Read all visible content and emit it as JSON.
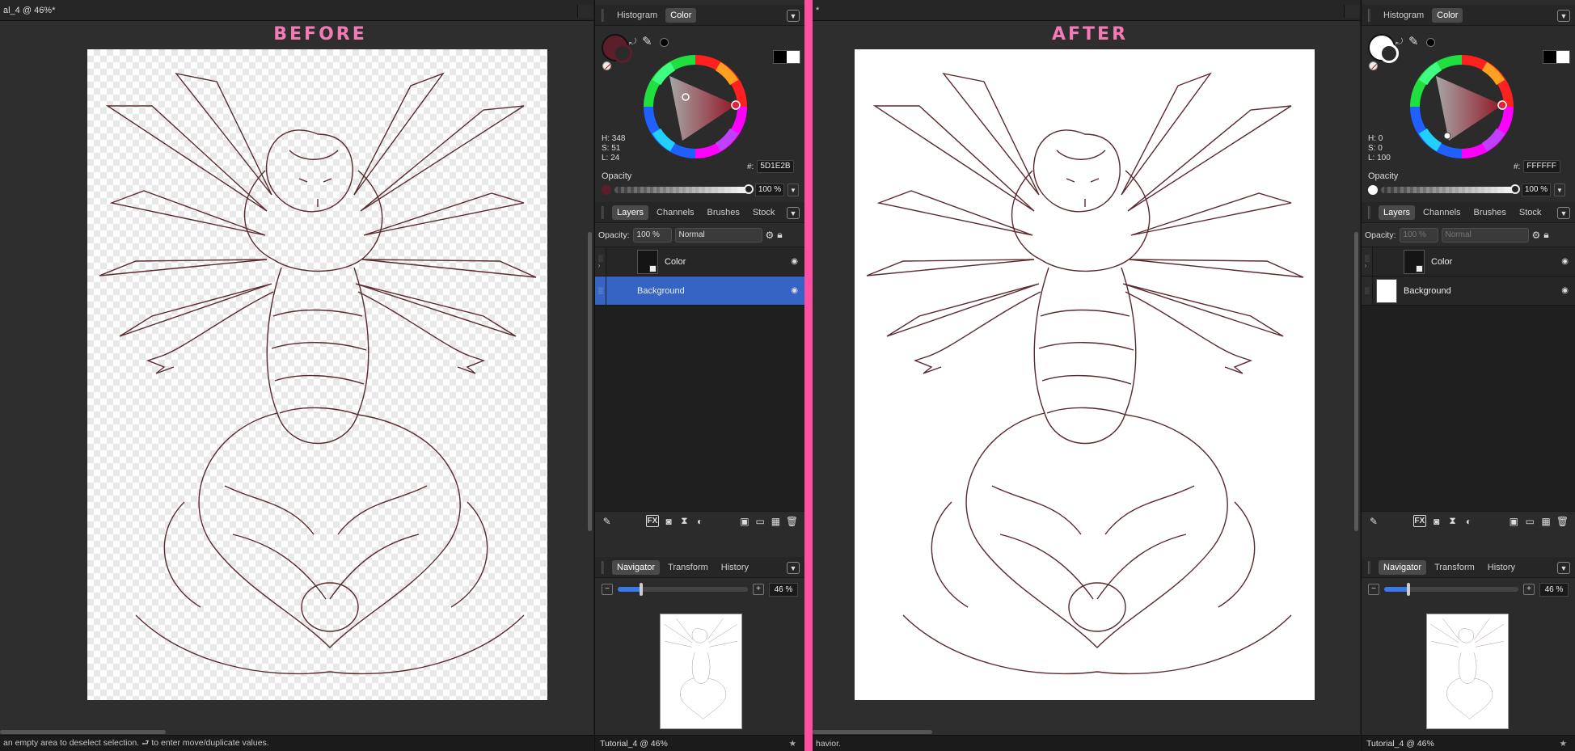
{
  "divider_color": "#ff4fa3",
  "left": {
    "doc_tab_title": "al_4 @ 46%*",
    "banner": "BEFORE",
    "status_text": "an empty area to deselect selection. ⮐ to enter move/duplicate values.",
    "color_panel": {
      "tabs": [
        "Histogram",
        "Color"
      ],
      "fill_color": "#5D1E2B",
      "hsl": {
        "h": "H: 348",
        "s": "S: 51",
        "l": "L: 24"
      },
      "hex_label": "#:",
      "hex_value": "5D1E2B",
      "opacity_label": "Opacity",
      "opacity_value": "100 %"
    },
    "layers_panel": {
      "tabs": [
        "Layers",
        "Channels",
        "Brushes",
        "Stock"
      ],
      "opacity_label": "Opacity:",
      "opacity_value": "100 %",
      "blend_mode": "Normal",
      "layers": [
        {
          "name": "Color",
          "selected": false
        },
        {
          "name": "Background",
          "selected": true
        }
      ]
    },
    "navigator_panel": {
      "tabs": [
        "Navigator",
        "Transform",
        "History"
      ],
      "zoom_value": "46 %",
      "zoom_fraction": 0.18
    },
    "panel_status": "Tutorial_4 @ 46%"
  },
  "right": {
    "doc_tab_title": "*",
    "banner": "AFTER",
    "status_text": "havior.",
    "color_panel": {
      "tabs": [
        "Histogram",
        "Color"
      ],
      "fill_color": "#FFFFFF",
      "hsl": {
        "h": "H: 0",
        "s": "S: 0",
        "l": "L: 100"
      },
      "hex_label": "#:",
      "hex_value": "FFFFFF",
      "opacity_label": "Opacity",
      "opacity_value": "100 %"
    },
    "layers_panel": {
      "tabs": [
        "Layers",
        "Channels",
        "Brushes",
        "Stock"
      ],
      "opacity_label": "Opacity:",
      "opacity_value": "100 %",
      "blend_mode": "Normal",
      "layers": [
        {
          "name": "Color",
          "selected": false
        },
        {
          "name": "Background",
          "selected": false
        }
      ]
    },
    "navigator_panel": {
      "tabs": [
        "Navigator",
        "Transform",
        "History"
      ],
      "zoom_value": "46 %",
      "zoom_fraction": 0.18
    },
    "panel_status": "Tutorial_4 @ 46%"
  },
  "icons": [
    "swap-icon",
    "eyedropper-icon",
    "eye-icon",
    "gear-icon",
    "lock-icon",
    "fx-icon",
    "trash-icon",
    "chevron-down-icon"
  ]
}
